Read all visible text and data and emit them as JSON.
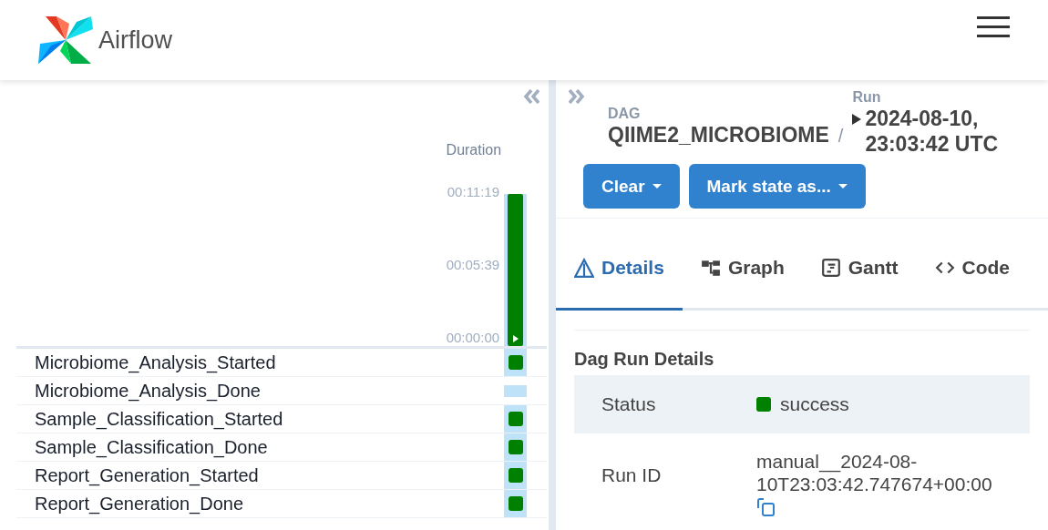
{
  "header": {
    "brand": "Airflow"
  },
  "grid": {
    "duration_label": "Duration",
    "ticks": [
      "00:11:19",
      "00:05:39",
      "00:00:00"
    ],
    "runs": [
      {
        "level": 1,
        "color": "#008000",
        "selected": true
      }
    ],
    "tasks": [
      {
        "name": "Microbiome_Analysis_Started",
        "color": "#008000"
      },
      {
        "name": "Microbiome_Analysis_Done"
      },
      {
        "name": "Sample_Classification_Started",
        "color": "#008000"
      },
      {
        "name": "Sample_Classification_Done",
        "color": "#008000"
      },
      {
        "name": "Report_Generation_Started",
        "color": "#008000"
      },
      {
        "name": "Report_Generation_Done",
        "color": "#008000"
      }
    ]
  },
  "breadcrumb": {
    "dag_label": "DAG",
    "dag": "QIIME2_MICROBIOME",
    "separator": "/",
    "run_label": "Run",
    "run": "2024-08-10, 23:03:42 UTC"
  },
  "buttons": [
    {
      "label": "Clear"
    },
    {
      "label": "Mark state as..."
    }
  ],
  "tabs": [
    {
      "label": "Details",
      "selected": true
    },
    {
      "label": "Graph",
      "selected": false
    },
    {
      "label": "Gantt",
      "selected": false
    },
    {
      "label": "Code",
      "selected": false
    }
  ],
  "details": {
    "title": "Dag Run Details",
    "rows": [
      {
        "label": "Status",
        "kind": "status",
        "value": "success",
        "color": "#008000"
      },
      {
        "label": "Run ID",
        "kind": "copy",
        "value": "manual__2024-08-10T23:03:42.747674+00:00"
      }
    ]
  }
}
